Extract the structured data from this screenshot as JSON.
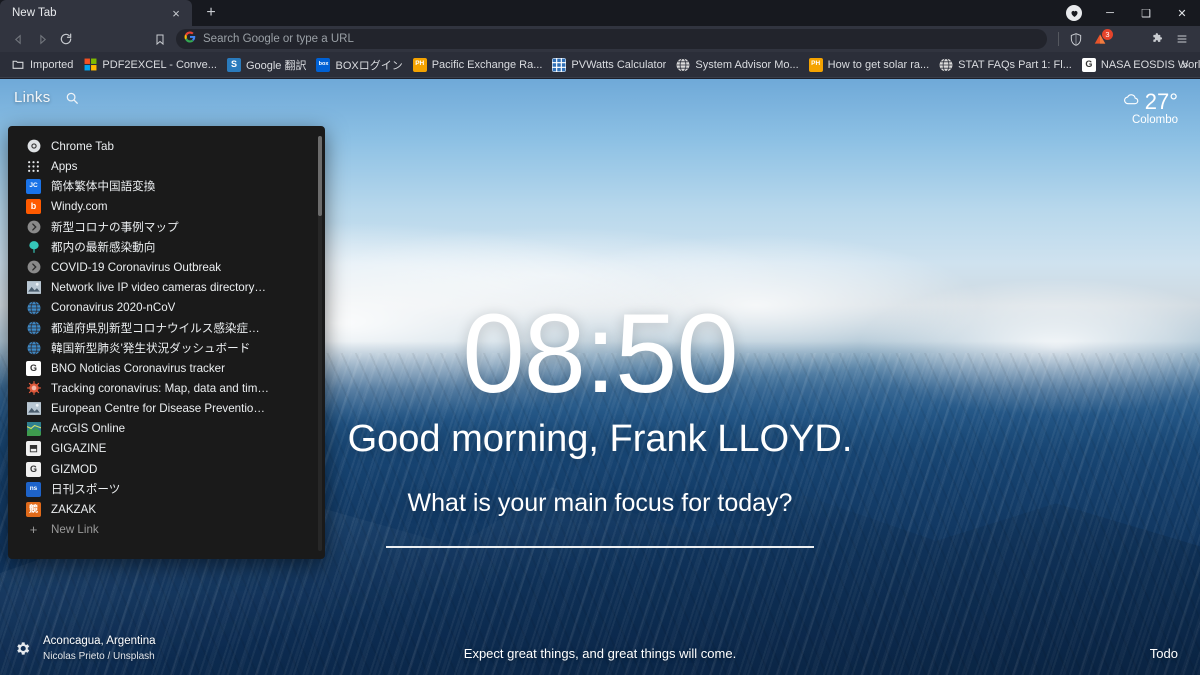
{
  "browser": {
    "tab": {
      "title": "New Tab",
      "close_label": "×"
    },
    "new_tab_button": "+",
    "window_controls": {
      "minimize": "─",
      "maximize": "❑",
      "close": "✕"
    },
    "nav": {
      "back": "back-arrow",
      "forward": "forward-arrow",
      "reload": "reload-arrow",
      "bookmark": "bookmark-outline"
    },
    "omnibox": {
      "value": "",
      "placeholder": "Search Google or type a URL",
      "search_engine": "google"
    },
    "shield_badge": "3",
    "extensions_label": "❖",
    "menu_label": "☰",
    "bookmarks_overflow": "»",
    "bookmarks": [
      {
        "label": "Imported",
        "icon": "folder",
        "color": "#d8dadd"
      },
      {
        "label": "PDF2EXCEL - Conve...",
        "icon": "ms-squares",
        "color": "#f25022"
      },
      {
        "label": "Google 翻訳",
        "icon": "letter",
        "letter": "S",
        "color": "#2a7bbd"
      },
      {
        "label": "BOXログイン",
        "icon": "letter",
        "letter": "box",
        "color": "#0061d5"
      },
      {
        "label": "Pacific Exchange Ra...",
        "icon": "letter",
        "letter": "PH",
        "color": "#f5a300"
      },
      {
        "label": "PVWatts Calculator",
        "icon": "grid",
        "color": "#2f6fb5"
      },
      {
        "label": "System Advisor Mo...",
        "icon": "globe",
        "color": "#dcdcdc"
      },
      {
        "label": "How to get solar ra...",
        "icon": "letter",
        "letter": "PH",
        "color": "#f5a300"
      },
      {
        "label": "STAT FAQs Part 1: Fl...",
        "icon": "globe",
        "color": "#dcdcdc"
      },
      {
        "label": "NASA EOSDIS Worl...",
        "icon": "letter",
        "letter": "G",
        "color": "#ffffff"
      }
    ]
  },
  "newtab": {
    "links_header": {
      "label": "Links",
      "search_icon": "search-icon"
    },
    "links_panel": {
      "items": [
        {
          "label": "Chrome Tab",
          "icon": "chrome",
          "color": "#e8eaed"
        },
        {
          "label": "Apps",
          "icon": "apps-grid",
          "color": "#e8eaed"
        },
        {
          "label": "簡体繁体中国語変換",
          "icon": "letter",
          "letter": "JC",
          "color": "#1a73e8"
        },
        {
          "label": "Windy.com",
          "icon": "letter",
          "letter": "b",
          "color": "#ff5a00"
        },
        {
          "label": "新型コロナの事例マップ",
          "icon": "chevron-circle",
          "color": "#8a8a8a"
        },
        {
          "label": "都内の最新感染動向",
          "icon": "tree",
          "color": "#35c5b8"
        },
        {
          "label": "COVID-19 Coronavirus Outbreak",
          "icon": "chevron-circle",
          "color": "#8a8a8a"
        },
        {
          "label": "Network live IP video cameras directory…",
          "icon": "photo",
          "color": "#9fb4c7"
        },
        {
          "label": "Coronavirus 2020-nCoV",
          "icon": "globe",
          "color": "#3e8bc8"
        },
        {
          "label": "都道府県別新型コロナウイルス感染症…",
          "icon": "globe",
          "color": "#3e8bc8"
        },
        {
          "label": "韓国新型肺炎'発生状況ダッシュボード",
          "icon": "globe",
          "color": "#3e8bc8"
        },
        {
          "label": "BNO Noticias Coronavirus tracker",
          "icon": "letter",
          "letter": "G",
          "color": "#ffffff"
        },
        {
          "label": "Tracking coronavirus: Map, data and tim…",
          "icon": "virus",
          "color": "#e05a3c"
        },
        {
          "label": "European Centre for Disease Preventio…",
          "icon": "photo",
          "color": "#9fb4c7"
        },
        {
          "label": "ArcGIS Online",
          "icon": "map",
          "color": "#3e9b4e"
        },
        {
          "label": "GIGAZINE",
          "icon": "letter",
          "letter": "⬒",
          "color": "#f0f0f0"
        },
        {
          "label": "GIZMOD",
          "icon": "letter",
          "letter": "G",
          "color": "#f0f0f0"
        },
        {
          "label": "日刊スポーツ",
          "icon": "letter",
          "letter": "ns",
          "color": "#1e63c9"
        },
        {
          "label": "ZAKZAK",
          "icon": "letter",
          "letter": "競",
          "color": "#e06a1a"
        },
        {
          "label": "New Link",
          "icon": "plus",
          "color": "#9a9a9a"
        }
      ]
    },
    "weather": {
      "temperature": "27°",
      "city": "Colombo",
      "icon": "cloud-icon"
    },
    "clock": "08:50",
    "greeting": "Good morning, Frank LLOYD.",
    "focus_question": "What is your main focus for today?",
    "focus_value": "",
    "photo_credit": {
      "location": "Aconcagua, Argentina",
      "author": "Nicolas Prieto / Unsplash",
      "settings_icon": "gear-icon"
    },
    "quote": "Expect great things, and great things will come.",
    "todo_label": "Todo"
  },
  "colors": {
    "tabstrip": "#17191f",
    "toolbar": "#31343f",
    "bookmarks_bar": "#2b2e39",
    "panel_bg": "#1a1a1a",
    "accent_badge": "#e5442b"
  }
}
